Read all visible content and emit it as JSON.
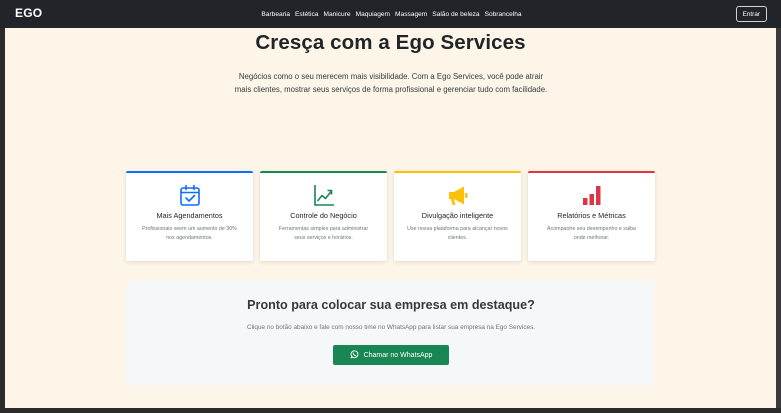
{
  "navbar": {
    "brand": "EGO",
    "links": [
      "Barbearia",
      "Estética",
      "Manicure",
      "Maquiagem",
      "Massagem",
      "Salão de beleza",
      "Sobrancelha"
    ],
    "login_label": "Entrar"
  },
  "hero": {
    "title": "Cresça com a Ego Services",
    "description_line1": "Negócios como o seu merecem mais visibilidade. Com a Ego Services, você pode atrair",
    "description_line2": "mais clientes, mostrar seus serviços de forma profissional e gerenciar tudo com facilidade."
  },
  "features": [
    {
      "icon": "calendar-check-icon",
      "accent": "#0d6efd",
      "title": "Mais Agendamentos",
      "desc_line1": "Profissionais veem um aumento de 30%",
      "desc_line2": "nos agendamentos."
    },
    {
      "icon": "graph-up-icon",
      "accent": "#198754",
      "title": "Controle do Negócio",
      "desc_line1": "Ferramentas simples para administrar",
      "desc_line2": "seus serviços e horários."
    },
    {
      "icon": "megaphone-icon",
      "accent": "#ffc107",
      "title": "Divulgação inteligente",
      "desc_line1": "Use nossa plataforma para alcançar novos",
      "desc_line2": "clientes."
    },
    {
      "icon": "bar-chart-icon",
      "accent": "#dc3545",
      "title": "Relatórios e Métricas",
      "desc_line1": "Acompanhe seu desempenho e saiba",
      "desc_line2": "onde melhorar."
    }
  ],
  "cta": {
    "title": "Pronto para colocar sua empresa em destaque?",
    "description": "Clique no botão abaixo e fale com nosso time no WhatsApp para listar sua empresa na Ego Services.",
    "button_label": "Chamar no WhatsApp",
    "button_icon": "whatsapp-icon",
    "button_color": "#198754"
  }
}
